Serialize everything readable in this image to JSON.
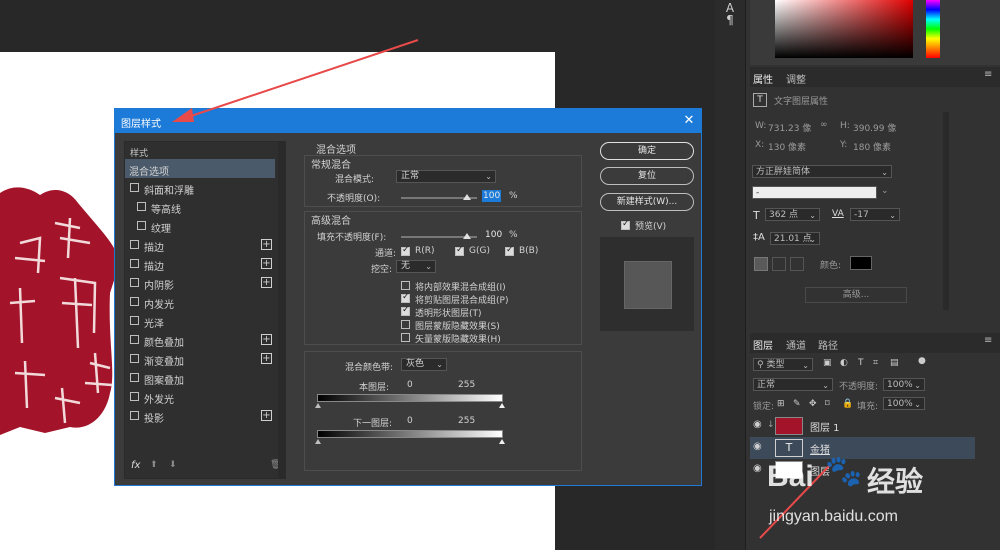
{
  "dialog": {
    "title": "图层样式",
    "close": "✕",
    "styles_header": "样式",
    "style_items": [
      {
        "label": "混合选项",
        "checkbox": false,
        "plus": false,
        "selected": true
      },
      {
        "label": "斜面和浮雕",
        "checkbox": true,
        "plus": false
      },
      {
        "label": "等高线",
        "checkbox": true,
        "plus": false,
        "indent": true
      },
      {
        "label": "纹理",
        "checkbox": true,
        "plus": false,
        "indent": true
      },
      {
        "label": "描边",
        "checkbox": true,
        "plus": true
      },
      {
        "label": "描边",
        "checkbox": true,
        "plus": true
      },
      {
        "label": "内阴影",
        "checkbox": true,
        "plus": true
      },
      {
        "label": "内发光",
        "checkbox": true,
        "plus": false
      },
      {
        "label": "光泽",
        "checkbox": true,
        "plus": false
      },
      {
        "label": "颜色叠加",
        "checkbox": true,
        "plus": true
      },
      {
        "label": "渐变叠加",
        "checkbox": true,
        "plus": true
      },
      {
        "label": "图案叠加",
        "checkbox": true,
        "plus": false
      },
      {
        "label": "外发光",
        "checkbox": true,
        "plus": false
      },
      {
        "label": "投影",
        "checkbox": true,
        "plus": true
      }
    ],
    "fx_label": "fx",
    "blend_options": {
      "title": "混合选项",
      "general_title": "常规混合",
      "blend_mode_label": "混合模式:",
      "blend_mode_value": "正常",
      "opacity_label": "不透明度(O):",
      "opacity_value": "100",
      "percent": "%",
      "advanced_title": "高级混合",
      "fill_opacity_label": "填充不透明度(F):",
      "fill_opacity_value": "100",
      "channels_label": "通道:",
      "channels": [
        {
          "label": "R(R)",
          "checked": true
        },
        {
          "label": "G(G)",
          "checked": true
        },
        {
          "label": "B(B)",
          "checked": true
        }
      ],
      "knockout_label": "挖空:",
      "knockout_value": "无",
      "options": [
        {
          "label": "将内部效果混合成组(I)",
          "checked": false
        },
        {
          "label": "将剪贴图层混合成组(P)",
          "checked": true
        },
        {
          "label": "透明形状图层(T)",
          "checked": true
        },
        {
          "label": "图层蒙版隐藏效果(S)",
          "checked": false
        },
        {
          "label": "矢量蒙版隐藏效果(H)",
          "checked": false
        }
      ],
      "blend_if_label": "混合颜色带:",
      "blend_if_value": "灰色",
      "this_layer_label": "本图层:",
      "this_layer_min": "0",
      "this_layer_max": "255",
      "under_layer_label": "下一图层:",
      "under_layer_min": "0",
      "under_layer_max": "255"
    },
    "buttons": {
      "ok": "确定",
      "reset": "复位",
      "new_style": "新建样式(W)...",
      "preview_label": "预览(V)",
      "preview_checked": true
    }
  },
  "properties_panel": {
    "tabs": [
      "属性",
      "调整"
    ],
    "type_title": "文字图层属性",
    "w_label": "W:",
    "w_value": "731.23 像",
    "h_label": "H:",
    "h_value": "390.99 像",
    "x_label": "X:",
    "x_value": "130 像素",
    "y_label": "Y:",
    "y_value": "180 像素",
    "font_family": "方正胖娃简体",
    "font_style": "-",
    "font_size": "362 点",
    "tracking_label": "VA",
    "tracking_value": "-17",
    "leading": "21.01 点",
    "color_label": "颜色:",
    "more_button": "高级..."
  },
  "layers_panel": {
    "tabs": [
      "图层",
      "通道",
      "路径"
    ],
    "filter_placeholder": "类型",
    "blend_mode": "正常",
    "opacity_label": "不透明度:",
    "opacity_value": "100%",
    "lock_label": "锁定:",
    "fill_label": "填充:",
    "fill_value": "100%",
    "layers": [
      {
        "name": "图层 1",
        "type": "image"
      },
      {
        "name": "金猪",
        "type": "text"
      },
      {
        "name": "图层",
        "type": "white"
      }
    ]
  },
  "watermark": {
    "brand": "Bai",
    "brand_cn": "经验",
    "url": "jingyan.baidu.com"
  },
  "colors": {
    "dialog_title_bar": "#1c7bd9",
    "selected_layer": "#3d4a5a",
    "artwork_red": "#a3142a"
  }
}
